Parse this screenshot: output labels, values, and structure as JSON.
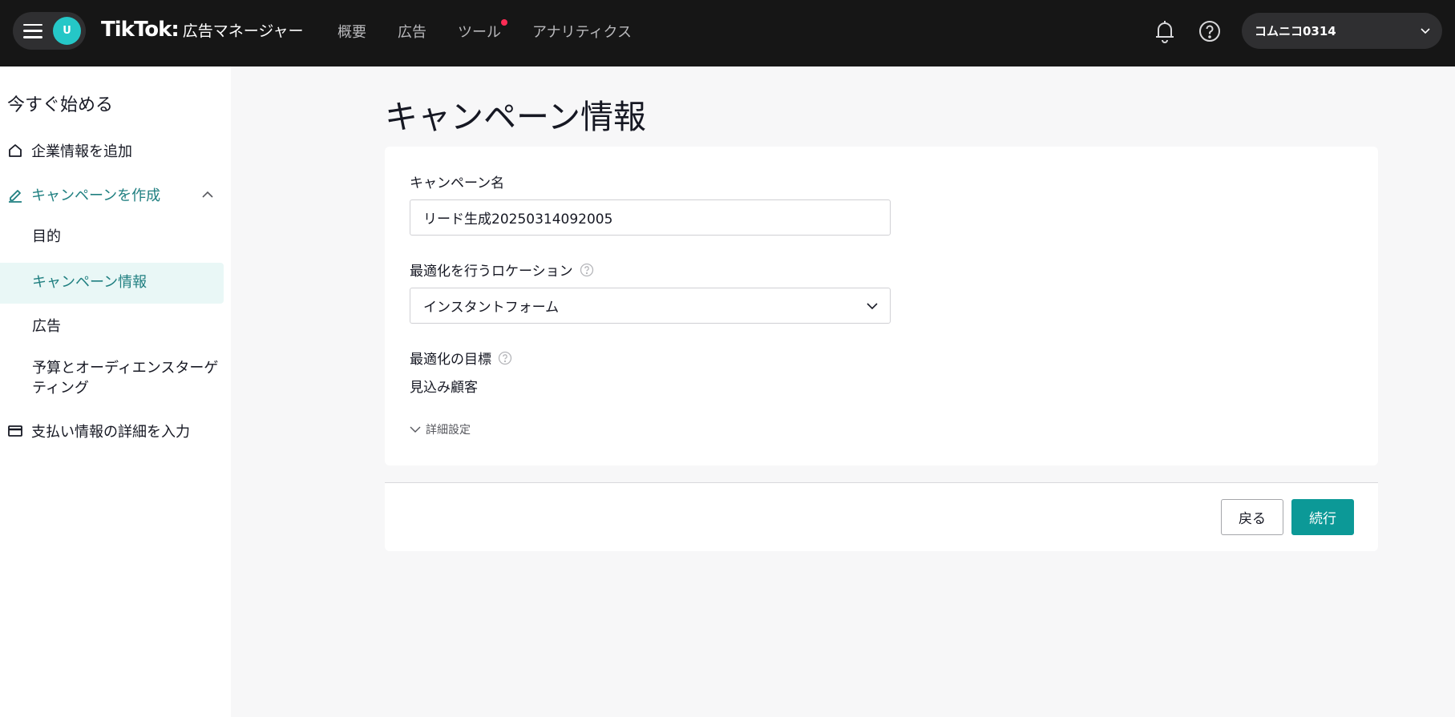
{
  "topbar": {
    "avatar_initial": "U",
    "brand_name": "TikTok",
    "brand_colon": ":",
    "brand_sub": "広告マネージャー",
    "nav": [
      "概要",
      "広告",
      "ツール",
      "アナリティクス"
    ],
    "account_name": "コムニコ0314",
    "accent_color": "#25c7c7",
    "notification_dot_color": "#fe2c55"
  },
  "sidebar": {
    "title": "今すぐ始める",
    "items": {
      "business_info": "企業情報を追加",
      "create_campaign": "キャンペーンを作成",
      "payment": "支払い情報の詳細を入力"
    },
    "subitems": {
      "objective": "目的",
      "campaign_info": "キャンペーン情報",
      "ads": "広告",
      "budget_line1": "予算とオーディエンスターゲ",
      "budget_line2": "ティング"
    },
    "active_color": "#1f7f80"
  },
  "main": {
    "page_title": "キャンペーン情報",
    "campaign_name_label": "キャンペーン名",
    "campaign_name_value": "リード生成20250314092005",
    "location_label": "最適化を行うロケーション",
    "location_value": "インスタントフォーム",
    "goal_label": "最適化の目標",
    "goal_value": "見込み顧客",
    "advanced_label": "詳細設定",
    "back_label": "戻る",
    "continue_label": "続行",
    "primary_color": "#0c9997"
  }
}
